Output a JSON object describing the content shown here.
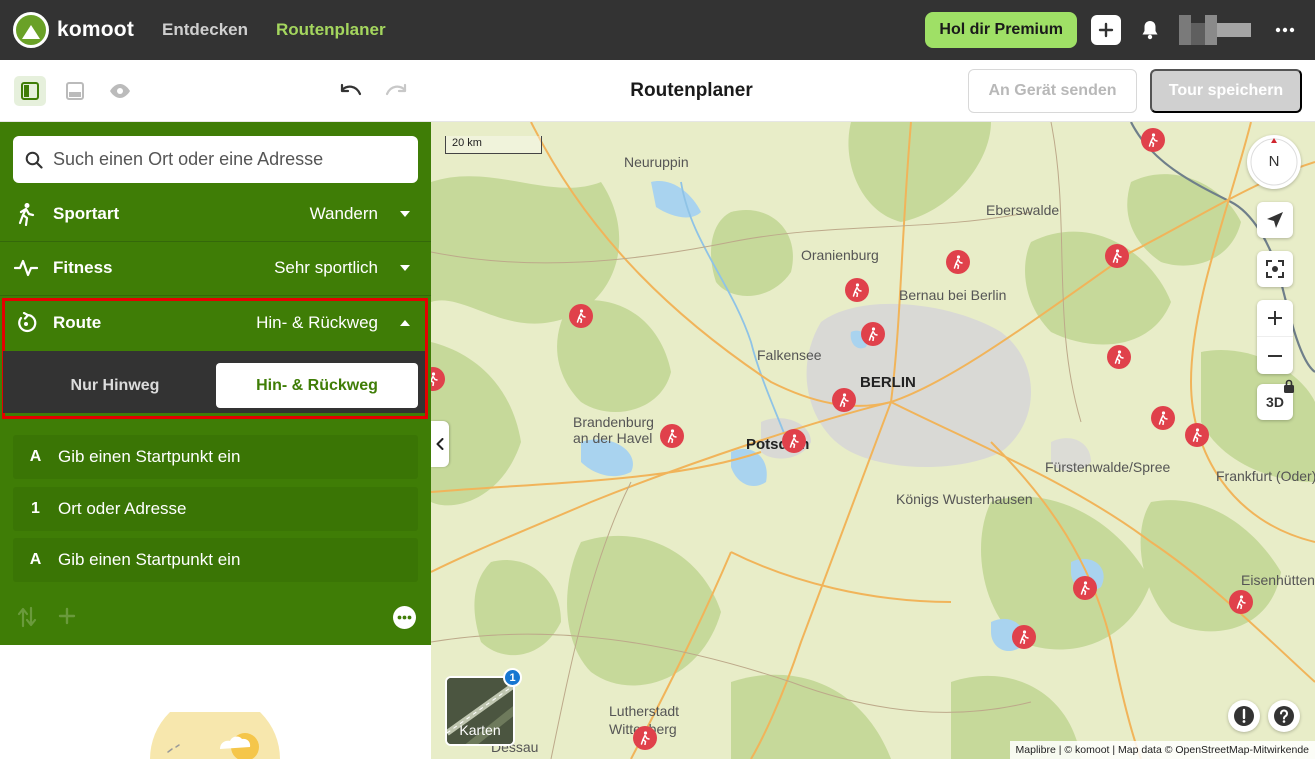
{
  "topnav": {
    "logo_text": "komoot",
    "links": [
      "Entdecken",
      "Routenplaner"
    ],
    "premium_label": "Hol dir Premium"
  },
  "toolbar": {
    "title": "Routenplaner",
    "send_label": "An Gerät senden",
    "save_label": "Tour speichern"
  },
  "sidebar": {
    "search_placeholder": "Such einen Ort oder eine Adresse",
    "options": [
      {
        "label": "Sportart",
        "value": "Wandern"
      },
      {
        "label": "Fitness",
        "value": "Sehr sportlich"
      },
      {
        "label": "Route",
        "value": "Hin- & Rückweg"
      }
    ],
    "route_toggle": {
      "one_way": "Nur Hinweg",
      "round_trip": "Hin- & Rückweg",
      "selected": "Hin- & Rückweg"
    },
    "waypoints": [
      {
        "key": "A",
        "text": "Gib einen Startpunkt ein"
      },
      {
        "key": "1",
        "text": "Ort oder Adresse"
      },
      {
        "key": "A",
        "text": "Gib einen Startpunkt ein"
      }
    ]
  },
  "map": {
    "scale_label": "20 km",
    "compass_label": "N",
    "three_d_label": "3D",
    "layers_label": "Karten",
    "layers_badge": "1",
    "attribution": "Maplibre | © komoot | Map data © OpenStreetMap-Mitwirkende",
    "places": {
      "neuruppin": "Neuruppin",
      "eberswalde": "Eberswalde",
      "oranienburg": "Oranienburg",
      "bernau": "Bernau bei Berlin",
      "falkensee": "Falkensee",
      "berlin": "BERLIN",
      "brandenburg1": "Brandenburg",
      "brandenburg2": "an der Havel",
      "potsdam": "Potsdam",
      "fuerstenwalde": "Fürstenwalde/Spree",
      "frankfurt": "Frankfurt (Oder)",
      "koenigs": "Königs Wusterhausen",
      "eisenhuetten": "Eisenhütten",
      "luther1": "Lutherstadt",
      "luther2": "Wittenberg",
      "dessau": "Dessau"
    }
  }
}
